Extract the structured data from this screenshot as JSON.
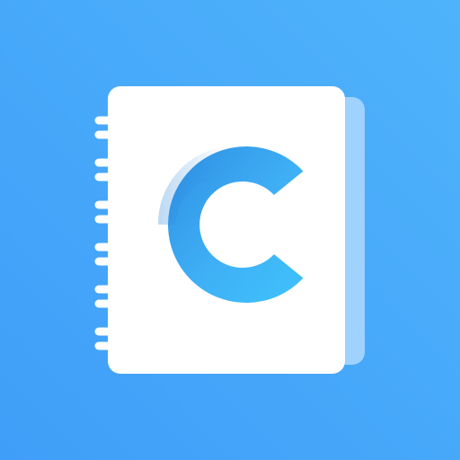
{
  "app_icon": {
    "icon_name": "notebook-letter-c-app-icon",
    "letter": "C",
    "colors": {
      "background_top_right": "#4fb3fb",
      "background_bottom_left": "#3f9ef8",
      "notebook_page": "#ffffff",
      "back_cover": "#9fd2ff",
      "letter_light": "#3fc2fb",
      "letter_dark": "#2f8fe3",
      "spiral_ring": "#ffffff"
    },
    "spiral_ring_count": 6
  }
}
